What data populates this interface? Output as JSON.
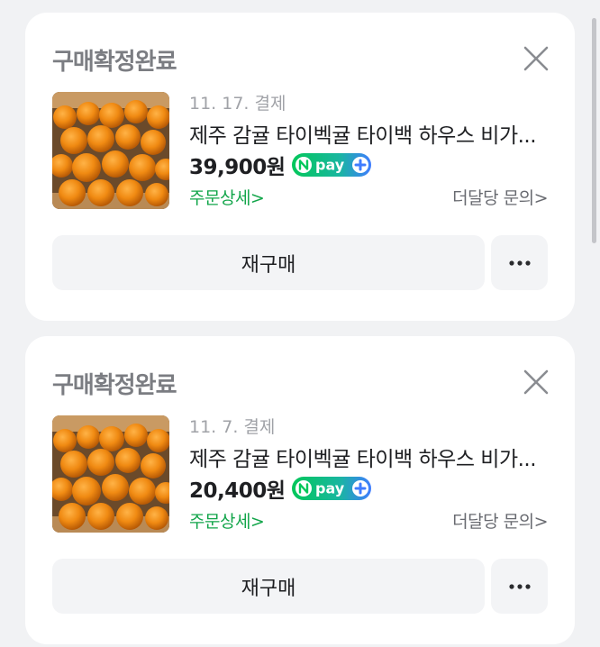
{
  "orders": [
    {
      "status": "구매확정완료",
      "date": "11. 17. 결제",
      "product_title": "제주 감귤 타이벡귤 타이백 하우스 비가...",
      "price": "39,900원",
      "payment_badge": "npay-plus-icon",
      "order_detail_link": "주문상세>",
      "inquiry_link": "더달당 문의>",
      "rebuy_label": "재구매",
      "thumbnail": "tangerine-box-image"
    },
    {
      "status": "구매확정완료",
      "date": "11. 7. 결제",
      "product_title": "제주 감귤 타이벡귤 타이백 하우스 비가...",
      "price": "20,400원",
      "payment_badge": "npay-plus-icon",
      "order_detail_link": "주문상세>",
      "inquiry_link": "더달당 문의>",
      "rebuy_label": "재구매",
      "thumbnail": "tangerine-box-image"
    }
  ],
  "colors": {
    "background": "#f1f2f4",
    "card": "#ffffff",
    "status_text": "#7b7d82",
    "order_detail_green": "#12a54a",
    "npay_green": "#03c75a",
    "npay_blue": "#3f7cff",
    "button_bg": "#f3f4f6"
  }
}
